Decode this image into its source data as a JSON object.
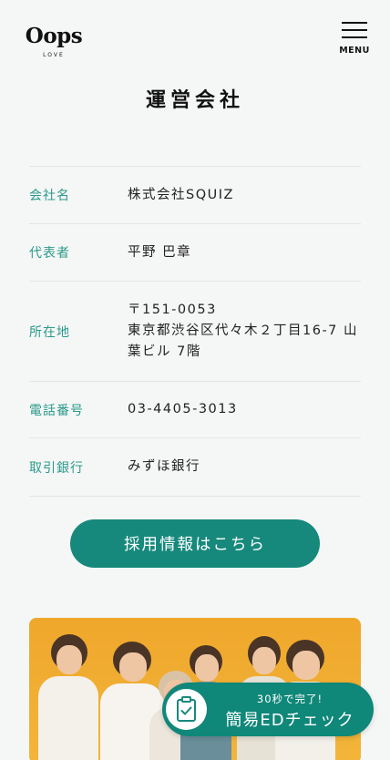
{
  "header": {
    "logo_main": "Oops",
    "logo_sub": "LOVE",
    "menu_label": "MENU"
  },
  "page_title": "運営会社",
  "company_info": [
    {
      "label": "会社名",
      "value": "株式会社SQUIZ"
    },
    {
      "label": "代表者",
      "value": "平野 巴章"
    },
    {
      "label": "所在地",
      "lines": [
        "〒151-0053",
        "東京都渋谷区代々木２丁目16-7 山",
        "葉ビル 7階"
      ]
    },
    {
      "label": "電話番号",
      "value": "03-4405-3013"
    },
    {
      "label": "取引銀行",
      "value": "みずほ銀行"
    }
  ],
  "recruit_button": {
    "label": "採用情報はこちら"
  },
  "ed_check_banner": {
    "sub_label": "30秒で完了!",
    "main_label": "簡易EDチェック",
    "icon": "clipboard-check-icon"
  },
  "colors": {
    "accent": "#16897c",
    "label_teal": "#2a9a8a",
    "photo_background": "#efa72b",
    "page_background": "#f5f6f6"
  }
}
